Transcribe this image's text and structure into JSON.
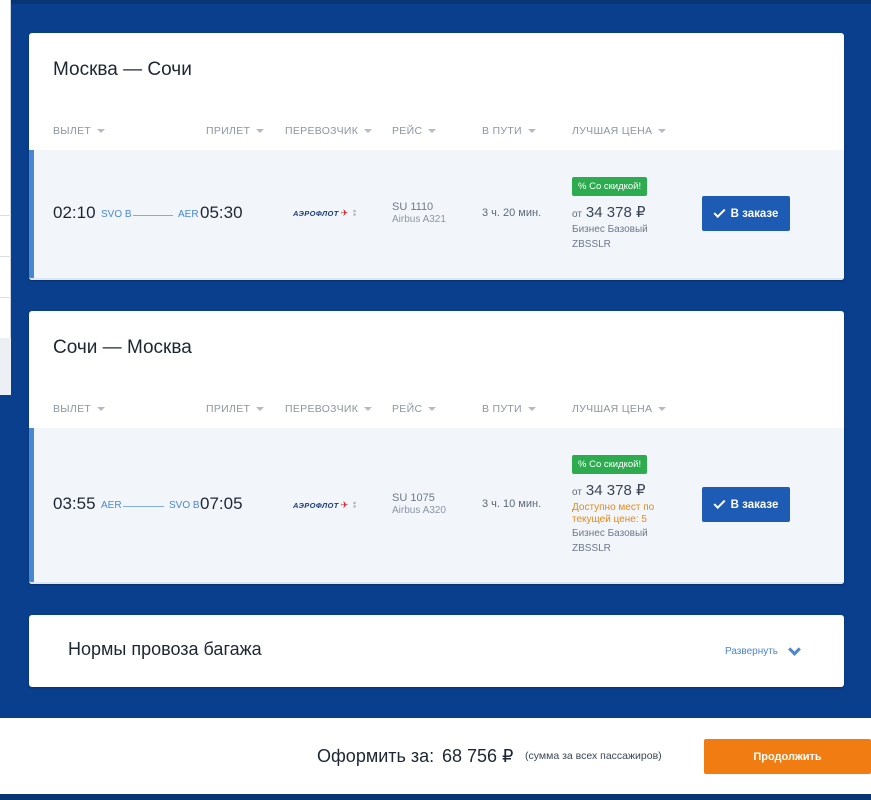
{
  "headers": {
    "departure": "ВЫЛЕТ",
    "arrival": "ПРИЛЕТ",
    "carrier": "ПЕРЕВОЗЧИК",
    "flight": "РЕЙС",
    "duration": "В ПУТИ",
    "best_price": "ЛУЧШАЯ ЦЕНА"
  },
  "segments": [
    {
      "title": "Москва — Сочи",
      "dep_time": "02:10",
      "dep_airport": "SVO B",
      "arr_airport": "AER",
      "arr_time": "05:30",
      "carrier_logo": "АЭРОФЛОТ",
      "flight_no": "SU 1110",
      "aircraft": "Airbus A321",
      "duration": "3 ч. 20 мин.",
      "badge": "% Со скидкой!",
      "price_prefix": "от",
      "price": "34 378 ₽",
      "seats_note": "",
      "fare_name": "Бизнес Базовый",
      "fare_code": "ZBSSLR",
      "button": "В заказе"
    },
    {
      "title": "Сочи — Москва",
      "dep_time": "03:55",
      "dep_airport": "AER",
      "arr_airport": "SVO B",
      "arr_time": "07:05",
      "carrier_logo": "АЭРОФЛОТ",
      "flight_no": "SU 1075",
      "aircraft": "Airbus A320",
      "duration": "3 ч. 10 мин.",
      "badge": "% Со скидкой!",
      "price_prefix": "от",
      "price": "34 378 ₽",
      "seats_note": "Доступно мест по текущей цене: 5",
      "fare_name": "Бизнес Базовый",
      "fare_code": "ZBSSLR",
      "button": "В заказе"
    }
  ],
  "baggage": {
    "title": "Нормы провоза багажа",
    "expand": "Развернуть"
  },
  "footer": {
    "label": "Оформить за:",
    "amount": "68 756 ₽",
    "note": "(сумма за всех пассажиров)",
    "continue": "Продолжить"
  },
  "colors": {
    "background": "#0a3f8d",
    "accent": "#4a87d3",
    "order_button": "#1e5bb5",
    "discount_badge": "#2cab4f",
    "continue_button": "#f07c12",
    "seats_warning": "#e28a1c"
  },
  "icons": {
    "sort": "caret-down-icon",
    "order": "check-icon",
    "expand": "chevron-down-icon"
  }
}
